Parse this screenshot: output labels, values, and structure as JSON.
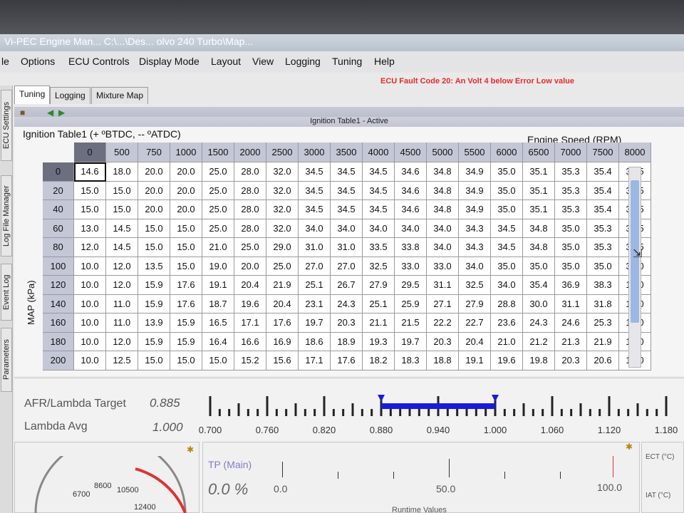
{
  "window": {
    "title": "Vi-PEC Engine Man... C:\\...\\Des... olvo 240 Turbo\\Map..."
  },
  "menu": [
    "le",
    "Options",
    "ECU Controls",
    "Display Mode",
    "Layout",
    "View",
    "Logging",
    "Tuning",
    "Help"
  ],
  "fault": "ECU Fault Code 20: An Volt 4 below Error Low value",
  "side_tabs": [
    "ECU Settings",
    "Log File Manager",
    "Event Log",
    "Parameters"
  ],
  "tabs": [
    "Tuning",
    "Logging",
    "Mixture Map"
  ],
  "panel_header": "Ignition Table1 - Active",
  "table": {
    "title": "Ignition Table1 (+ ºBTDC, -- ºATDC)",
    "x_label": "Engine Speed (RPM)",
    "y_label": "MAP (kPa)",
    "rpm": [
      "0",
      "500",
      "750",
      "1000",
      "1500",
      "2000",
      "2500",
      "3000",
      "3500",
      "4000",
      "4500",
      "5000",
      "5500",
      "6000",
      "6500",
      "7000",
      "7500",
      "8000"
    ],
    "map": [
      "0",
      "20",
      "40",
      "60",
      "80",
      "100",
      "120",
      "140",
      "160",
      "180",
      "200"
    ],
    "rows": [
      [
        "14.6",
        "18.0",
        "20.0",
        "20.0",
        "25.0",
        "28.0",
        "32.0",
        "34.5",
        "34.5",
        "34.5",
        "34.6",
        "34.8",
        "34.9",
        "35.0",
        "35.1",
        "35.3",
        "35.4",
        "35.5"
      ],
      [
        "15.0",
        "15.0",
        "20.0",
        "20.0",
        "25.0",
        "28.0",
        "32.0",
        "34.5",
        "34.5",
        "34.5",
        "34.6",
        "34.8",
        "34.9",
        "35.0",
        "35.1",
        "35.3",
        "35.4",
        "35.5"
      ],
      [
        "15.0",
        "15.0",
        "20.0",
        "20.0",
        "25.0",
        "28.0",
        "32.0",
        "34.5",
        "34.5",
        "34.5",
        "34.6",
        "34.8",
        "34.9",
        "35.0",
        "35.1",
        "35.3",
        "35.4",
        "35.5"
      ],
      [
        "13.0",
        "14.5",
        "15.0",
        "15.0",
        "25.0",
        "28.0",
        "32.0",
        "34.0",
        "34.0",
        "34.0",
        "34.0",
        "34.0",
        "34.3",
        "34.5",
        "34.8",
        "35.0",
        "35.3",
        "35.5"
      ],
      [
        "12.0",
        "14.5",
        "15.0",
        "15.0",
        "21.0",
        "25.0",
        "29.0",
        "31.0",
        "31.0",
        "33.5",
        "33.8",
        "34.0",
        "34.3",
        "34.5",
        "34.8",
        "35.0",
        "35.3",
        "35.5"
      ],
      [
        "10.0",
        "12.0",
        "13.5",
        "15.0",
        "19.0",
        "20.0",
        "25.0",
        "27.0",
        "27.0",
        "32.5",
        "33.0",
        "33.0",
        "34.0",
        "35.0",
        "35.0",
        "35.0",
        "35.0",
        "35.0"
      ],
      [
        "10.0",
        "12.0",
        "15.9",
        "17.6",
        "19.1",
        "20.4",
        "21.9",
        "25.1",
        "26.7",
        "27.9",
        "29.5",
        "31.1",
        "32.5",
        "34.0",
        "35.4",
        "36.9",
        "38.3",
        "18.0"
      ],
      [
        "10.0",
        "11.0",
        "15.9",
        "17.6",
        "18.7",
        "19.6",
        "20.4",
        "23.1",
        "24.3",
        "25.1",
        "25.9",
        "27.1",
        "27.9",
        "28.8",
        "30.0",
        "31.1",
        "31.8",
        "17.0"
      ],
      [
        "10.0",
        "11.0",
        "13.9",
        "15.9",
        "16.5",
        "17.1",
        "17.6",
        "19.7",
        "20.3",
        "21.1",
        "21.5",
        "22.2",
        "22.7",
        "23.6",
        "24.3",
        "24.6",
        "25.3",
        "16.0"
      ],
      [
        "10.0",
        "12.0",
        "15.9",
        "15.9",
        "16.4",
        "16.6",
        "16.9",
        "18.6",
        "18.9",
        "19.3",
        "19.7",
        "20.3",
        "20.4",
        "21.0",
        "21.2",
        "21.3",
        "21.9",
        "15.0"
      ],
      [
        "10.0",
        "12.5",
        "15.0",
        "15.0",
        "15.0",
        "15.2",
        "15.6",
        "17.1",
        "17.6",
        "18.2",
        "18.3",
        "18.8",
        "19.1",
        "19.6",
        "19.8",
        "20.3",
        "20.6",
        "14.0"
      ]
    ]
  },
  "afr": {
    "target_label": "AFR/Lambda Target",
    "target_value": "0.885",
    "avg_label": "Lambda Avg",
    "avg_value": "1.000",
    "scale_ticks": [
      "0.700",
      "0.760",
      "0.820",
      "0.880",
      "0.940",
      "1.000",
      "1.060",
      "1.120",
      "1.180"
    ],
    "range_start": 0.88,
    "range_end": 1.0,
    "bar_color": "#1a1adf"
  },
  "tp": {
    "label": "TP (Main)",
    "value": "0.0 %",
    "ticks": [
      "0.0",
      "50.0",
      "100.0"
    ],
    "marker_color": "#e03131"
  },
  "ect_label": "ECT (°C)",
  "iat_label": "IAT (°C)",
  "tacho_ticks": [
    "6700",
    "8600",
    "10500",
    "12400"
  ],
  "runtime_label": "Runtime Values"
}
